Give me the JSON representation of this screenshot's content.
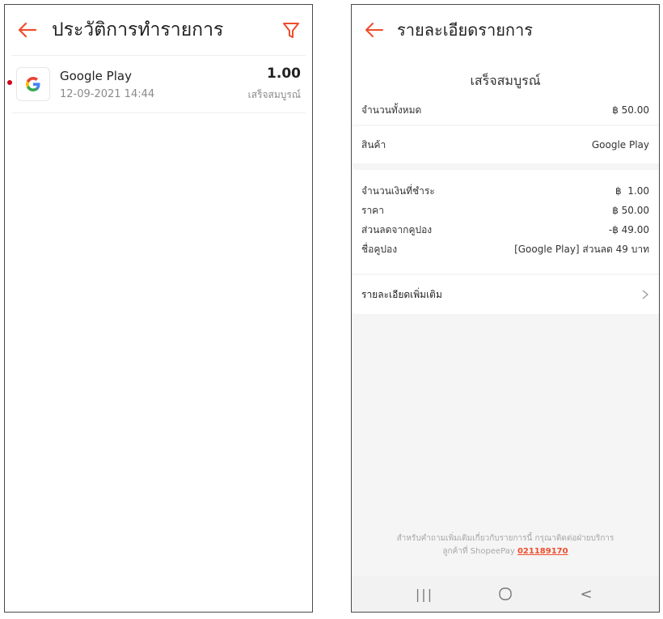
{
  "left": {
    "header": {
      "title": "ประวัติการทำรายการ"
    },
    "transactions": [
      {
        "name": "Google Play",
        "date": "12-09-2021 14:44",
        "amount": "1.00",
        "status": "เสร็จสมบูรณ์",
        "logo_letter": "G"
      }
    ]
  },
  "right": {
    "header": {
      "title": "รายละเอียดรายการ"
    },
    "status": "เสร็จสมบูรณ์",
    "total": {
      "label": "จำนวนทั้งหมด",
      "value": "฿ 50.00"
    },
    "product": {
      "label": "สินค้า",
      "value": "Google Play"
    },
    "payment": [
      {
        "label": "จำนวนเงินที่ชำระ",
        "value": "฿  1.00"
      },
      {
        "label": "ราคา",
        "value": "฿ 50.00"
      },
      {
        "label": "ส่วนลดจากคูปอง",
        "value": "-฿ 49.00"
      },
      {
        "label": "ชื่อคูปอง",
        "value": "[Google Play] ส่วนลด 49 บาท"
      }
    ],
    "more_details": "รายละเอียดเพิ่มเติม",
    "footer": {
      "line1": "สำหรับคำถามเพิ่มเติมเกี่ยวกับรายการนี้ กรุณาติดต่อฝ่ายบริการ",
      "line2_prefix": "ลูกค้าที่ ShopeePay ",
      "phone": "021189170"
    },
    "navbar": {
      "recents": "|||",
      "back": "<"
    }
  },
  "colors": {
    "accent": "#ee4d2d",
    "dot": "#d0021b",
    "muted": "#8a8a8a"
  },
  "icons": [
    "back-arrow-icon",
    "filter-icon",
    "google-logo-icon",
    "chevron-right-icon",
    "home-circle-icon"
  ]
}
